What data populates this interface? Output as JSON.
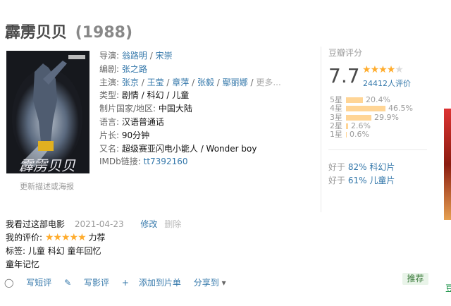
{
  "title": {
    "name": "霹雳贝贝",
    "year": "(1988)"
  },
  "poster": {
    "link_text": "更新描述或海报"
  },
  "info": {
    "director_label": "导演:",
    "directors": [
      "翁路明",
      "宋崇"
    ],
    "writer_label": "编剧:",
    "writers": [
      "张之路"
    ],
    "cast_label": "主演:",
    "cast": [
      "张京",
      "王莹",
      "章萍",
      "张毅",
      "鄢丽娜"
    ],
    "cast_more": "更多...",
    "genre_label": "类型:",
    "genres": "剧情 / 科幻 / 儿童",
    "region_label": "制片国家/地区:",
    "region": "中国大陆",
    "language_label": "语言:",
    "language": "汉语普通话",
    "runtime_label": "片长:",
    "runtime": "90分钟",
    "aka_label": "又名:",
    "aka": "超级赛亚闪电小能人 / Wonder boy",
    "imdb_label": "IMDb链接:",
    "imdb": "tt7392160"
  },
  "rating": {
    "header": "豆瓣评分",
    "score": "7.7",
    "stars_filled": 4,
    "stars_total": 5,
    "count_text": "24412人评价",
    "distribution": [
      {
        "label": "5星",
        "percent": 20.4,
        "text": "20.4%"
      },
      {
        "label": "4星",
        "percent": 46.5,
        "text": "46.5%"
      },
      {
        "label": "3星",
        "percent": 29.9,
        "text": "29.9%"
      },
      {
        "label": "2星",
        "percent": 2.6,
        "text": "2.6%"
      },
      {
        "label": "1星",
        "percent": 0.6,
        "text": "0.6%"
      }
    ],
    "better": [
      {
        "prefix": "好于",
        "pct": "82%",
        "genre": "科幻片"
      },
      {
        "prefix": "好于",
        "pct": "61%",
        "genre": "儿童片"
      }
    ]
  },
  "my": {
    "watched": "我看过这部电影",
    "date": "2021-04-23",
    "edit": "修改",
    "delete": "删除",
    "my_rating_label": "我的评价:",
    "my_stars": "★★★★★",
    "my_rating_word": "力荐",
    "tags_label": "标签:",
    "tags": "儿童 科幻 童年回忆",
    "comment": "童年记忆"
  },
  "actions": {
    "short_review": "写短评",
    "review": "写影评",
    "add_list": "添加到片单",
    "share": "分享到"
  },
  "recommend": "推荐",
  "side_text": "豆",
  "colors": {
    "link": "#3377aa",
    "star": "#ffac2d",
    "bar": "#ffd596"
  }
}
